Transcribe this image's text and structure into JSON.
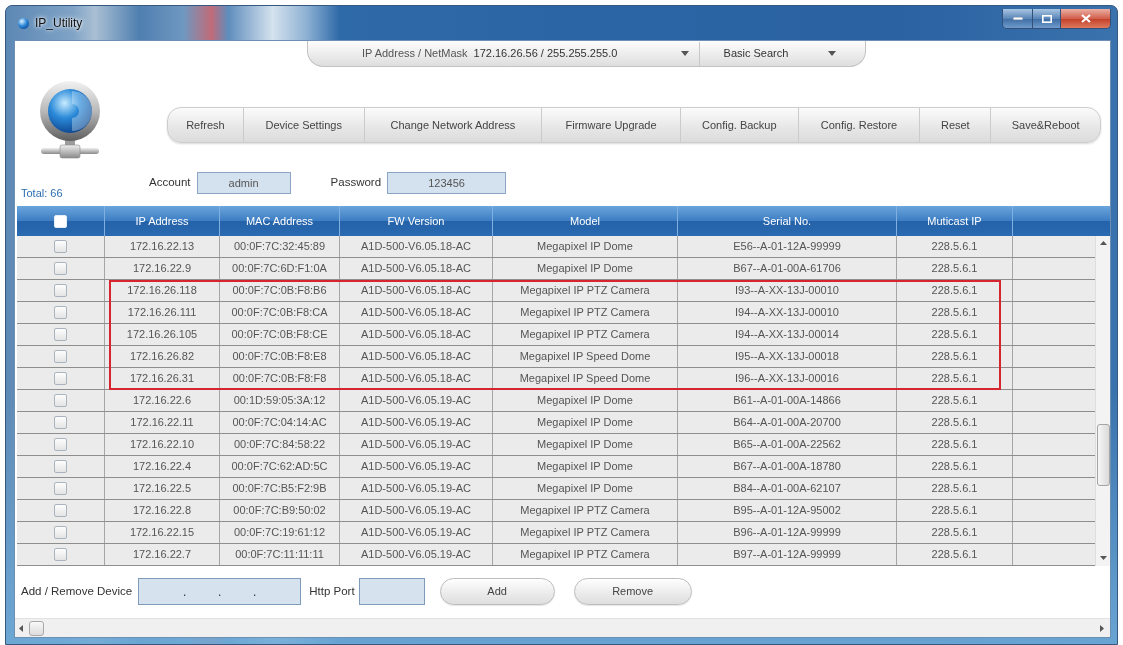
{
  "window": {
    "title": "IP_Utility"
  },
  "search_bar": {
    "label": "IP Address / NetMask",
    "network_dropdown": "172.16.26.56 / 255.255.255.0",
    "mode_dropdown": "Basic Search"
  },
  "toolbar": {
    "buttons": [
      "Refresh",
      "Device Settings",
      "Change Network Address",
      "Firmware Upgrade",
      "Config. Backup",
      "Config. Restore",
      "Reset",
      "Save&Reboot"
    ]
  },
  "credentials": {
    "account": {
      "label": "Account",
      "value": "admin"
    },
    "password": {
      "label": "Password",
      "value": "123456"
    }
  },
  "total": "Total: 66",
  "table": {
    "select_all_checked": false,
    "columns": [
      "IP Address",
      "MAC Address",
      "FW Version",
      "Model",
      "Serial No.",
      "Muticast IP"
    ],
    "rows": [
      {
        "checked": false,
        "highlighted": false,
        "cells": [
          "172.16.22.13",
          "00:0F:7C:32:45:89",
          "A1D-500-V6.05.18-AC",
          "Megapixel IP Dome",
          "E56--A-01-12A-99999",
          "228.5.6.1"
        ]
      },
      {
        "checked": false,
        "highlighted": false,
        "cells": [
          "172.16.22.9",
          "00:0F:7C:6D:F1:0A",
          "A1D-500-V6.05.18-AC",
          "Megapixel IP Dome",
          "B67--A-01-00A-61706",
          "228.5.6.1"
        ]
      },
      {
        "checked": false,
        "highlighted": true,
        "cells": [
          "172.16.26.118",
          "00:0F:7C:0B:F8:B6",
          "A1D-500-V6.05.18-AC",
          "Megapixel IP PTZ Camera",
          "I93--A-XX-13J-00010",
          "228.5.6.1"
        ]
      },
      {
        "checked": false,
        "highlighted": true,
        "cells": [
          "172.16.26.111",
          "00:0F:7C:0B:F8:CA",
          "A1D-500-V6.05.18-AC",
          "Megapixel IP PTZ Camera",
          "I94--A-XX-13J-00010",
          "228.5.6.1"
        ]
      },
      {
        "checked": false,
        "highlighted": true,
        "cells": [
          "172.16.26.105",
          "00:0F:7C:0B:F8:CE",
          "A1D-500-V6.05.18-AC",
          "Megapixel IP PTZ Camera",
          "I94--A-XX-13J-00014",
          "228.5.6.1"
        ]
      },
      {
        "checked": false,
        "highlighted": true,
        "cells": [
          "172.16.26.82",
          "00:0F:7C:0B:F8:E8",
          "A1D-500-V6.05.18-AC",
          "Megapixel IP Speed Dome",
          "I95--A-XX-13J-00018",
          "228.5.6.1"
        ]
      },
      {
        "checked": false,
        "highlighted": true,
        "cells": [
          "172.16.26.31",
          "00:0F:7C:0B:F8:F8",
          "A1D-500-V6.05.18-AC",
          "Megapixel IP Speed Dome",
          "I96--A-XX-13J-00016",
          "228.5.6.1"
        ]
      },
      {
        "checked": false,
        "highlighted": false,
        "cells": [
          "172.16.22.6",
          "00:1D:59:05:3A:12",
          "A1D-500-V6.05.19-AC",
          "Megapixel IP Dome",
          "B61--A-01-00A-14866",
          "228.5.6.1"
        ]
      },
      {
        "checked": false,
        "highlighted": false,
        "cells": [
          "172.16.22.11",
          "00:0F:7C:04:14:AC",
          "A1D-500-V6.05.19-AC",
          "Megapixel IP Dome",
          "B64--A-01-00A-20700",
          "228.5.6.1"
        ]
      },
      {
        "checked": false,
        "highlighted": false,
        "cells": [
          "172.16.22.10",
          "00:0F:7C:84:58:22",
          "A1D-500-V6.05.19-AC",
          "Megapixel IP Dome",
          "B65--A-01-00A-22562",
          "228.5.6.1"
        ]
      },
      {
        "checked": false,
        "highlighted": false,
        "cells": [
          "172.16.22.4",
          "00:0F:7C:62:AD:5C",
          "A1D-500-V6.05.19-AC",
          "Megapixel IP Dome",
          "B67--A-01-00A-18780",
          "228.5.6.1"
        ]
      },
      {
        "checked": false,
        "highlighted": false,
        "cells": [
          "172.16.22.5",
          "00:0F:7C:B5:F2:9B",
          "A1D-500-V6.05.19-AC",
          "Megapixel IP Dome",
          "B84--A-01-00A-62107",
          "228.5.6.1"
        ]
      },
      {
        "checked": false,
        "highlighted": false,
        "cells": [
          "172.16.22.8",
          "00:0F:7C:B9:50:02",
          "A1D-500-V6.05.19-AC",
          "Megapixel IP PTZ Camera",
          "B95--A-01-12A-95002",
          "228.5.6.1"
        ]
      },
      {
        "checked": false,
        "highlighted": false,
        "cells": [
          "172.16.22.15",
          "00:0F:7C:19:61:12",
          "A1D-500-V6.05.19-AC",
          "Megapixel IP PTZ Camera",
          "B96--A-01-12A-99999",
          "228.5.6.1"
        ]
      },
      {
        "checked": false,
        "highlighted": false,
        "cells": [
          "172.16.22.7",
          "00:0F:7C:11:11:11",
          "A1D-500-V6.05.19-AC",
          "Megapixel IP PTZ Camera",
          "B97--A-01-12A-99999",
          "228.5.6.1"
        ]
      }
    ]
  },
  "add_remove": {
    "label": "Add / Remove Device",
    "ip_separators": [
      ".",
      ".",
      "."
    ],
    "port_label": "Http Port",
    "buttons": [
      "Add",
      "Remove"
    ]
  }
}
